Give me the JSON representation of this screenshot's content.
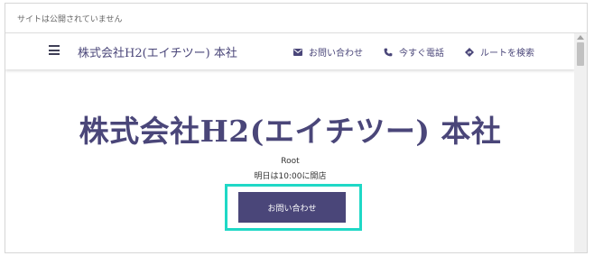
{
  "notice": {
    "text": "サイトは公開されていません"
  },
  "header": {
    "brand": "株式会社H2(エイチツー) 本社",
    "nav": [
      {
        "icon": "mail-icon",
        "label": "お問い合わせ"
      },
      {
        "icon": "phone-icon",
        "label": "今すぐ電話"
      },
      {
        "icon": "directions-icon",
        "label": "ルートを検索"
      }
    ]
  },
  "hero": {
    "title": "株式会社H2(エイチツー) 本社",
    "category": "Root",
    "hours": "明日は10:00に開店",
    "cta_label": "お問い合わせ"
  },
  "colors": {
    "brand": "#4a4679",
    "highlight": "#1fd8c6"
  }
}
